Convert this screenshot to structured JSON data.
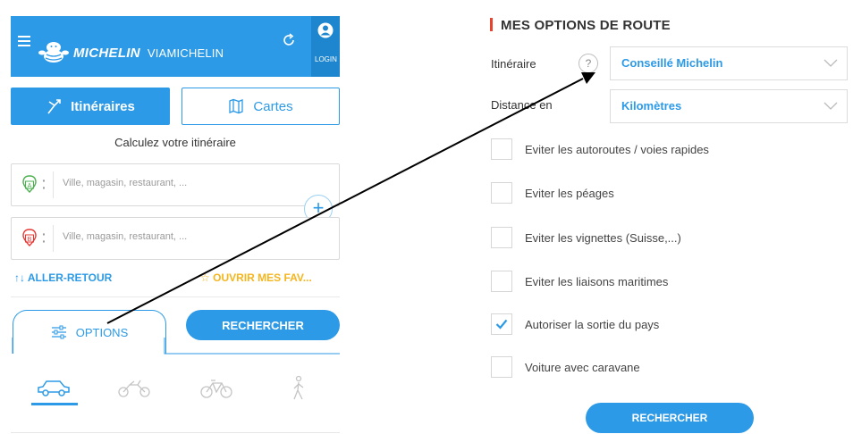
{
  "header": {
    "brand": "MICHELIN",
    "product": "VIAMICHELIN",
    "login_label": "LOGIN"
  },
  "nav": {
    "itineraires_label": "Itinéraires",
    "cartes_label": "Cartes"
  },
  "form": {
    "title": "Calculez votre itinéraire",
    "start_placeholder": "Ville, magasin, restaurant, ...",
    "end_placeholder": "Ville, magasin, restaurant, ...",
    "start_marker": "A",
    "end_marker": "B",
    "add_step_label": "+",
    "aller_retour_label": "ALLER-RETOUR",
    "favoris_label": "OUVRIR MES FAV...",
    "options_label": "OPTIONS",
    "rechercher_label": "RECHERCHER"
  },
  "modes": [
    {
      "icon": "car-icon",
      "active": true
    },
    {
      "icon": "motorcycle-icon",
      "active": false
    },
    {
      "icon": "bicycle-icon",
      "active": false
    },
    {
      "icon": "pedestrian-icon",
      "active": false
    }
  ],
  "route_options": {
    "title": "MES OPTIONS DE ROUTE",
    "itineraire_label": "Itinéraire",
    "help_label": "?",
    "itineraire_value": "Conseillé Michelin",
    "distance_label": "Distance en",
    "distance_value": "Kilomètres",
    "checkboxes": [
      {
        "label": "Eviter les autoroutes / voies rapides",
        "checked": false
      },
      {
        "label": "Eviter les péages",
        "checked": false
      },
      {
        "label": "Eviter les vignettes (Suisse,...)",
        "checked": false
      },
      {
        "label": "Eviter les liaisons maritimes",
        "checked": false
      },
      {
        "label": "Autoriser la sortie du pays",
        "checked": true
      },
      {
        "label": "Voiture avec caravane",
        "checked": false
      }
    ],
    "rechercher_label": "RECHERCHER"
  },
  "colors": {
    "brand_blue": "#2c9ae6",
    "accent_red": "#e8432f",
    "favoris_yellow": "#f5b51e"
  }
}
